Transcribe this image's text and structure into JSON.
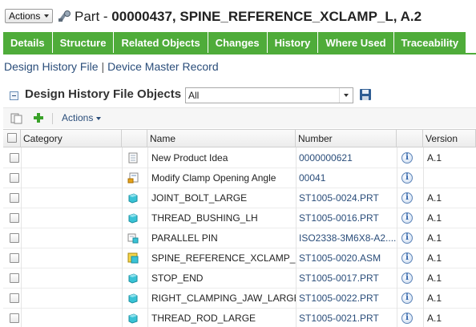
{
  "header": {
    "actions_label": "Actions",
    "title_prefix": "Part - ",
    "title_main": "00000437, SPINE_REFERENCE_XCLAMP_L, A.2"
  },
  "tabs": [
    {
      "label": "Details"
    },
    {
      "label": "Structure"
    },
    {
      "label": "Related Objects"
    },
    {
      "label": "Changes"
    },
    {
      "label": "History"
    },
    {
      "label": "Where Used"
    },
    {
      "label": "Traceability"
    }
  ],
  "subnav": {
    "link1": "Design History File",
    "separator": "|",
    "link2": "Device Master Record"
  },
  "section": {
    "title": "Design History File Objects",
    "filter_value": "All"
  },
  "toolbar": {
    "actions_label": "Actions"
  },
  "table": {
    "columns": [
      "Category",
      "Name",
      "Number",
      "Version"
    ],
    "rows": [
      {
        "icon": "document-icon",
        "name": "New Product Idea",
        "number": "0000000621",
        "version": "A.1"
      },
      {
        "icon": "change-request-icon",
        "name": "Modify Clamp Opening Angle",
        "number": "00041",
        "version": ""
      },
      {
        "icon": "part-icon",
        "name": "JOINT_BOLT_LARGE",
        "number": "ST1005-0024.PRT",
        "version": "A.1"
      },
      {
        "icon": "part-icon",
        "name": "THREAD_BUSHING_LH",
        "number": "ST1005-0016.PRT",
        "version": "A.1"
      },
      {
        "icon": "standard-part-icon",
        "name": "PARALLEL PIN",
        "number": "ISO2338-3M6X8-A2....",
        "version": "A.1"
      },
      {
        "icon": "assembly-icon",
        "name": "SPINE_REFERENCE_XCLAMP_L",
        "number": "ST1005-0020.ASM",
        "version": "A.1"
      },
      {
        "icon": "part-icon",
        "name": "STOP_END",
        "number": "ST1005-0017.PRT",
        "version": "A.1"
      },
      {
        "icon": "part-icon",
        "name": "RIGHT_CLAMPING_JAW_LARGE",
        "number": "ST1005-0022.PRT",
        "version": "A.1"
      },
      {
        "icon": "part-icon",
        "name": "THREAD_ROD_LARGE",
        "number": "ST1005-0021.PRT",
        "version": "A.1"
      }
    ]
  },
  "colors": {
    "tab_green": "#4fac3a",
    "link_blue": "#2a4d7a"
  }
}
